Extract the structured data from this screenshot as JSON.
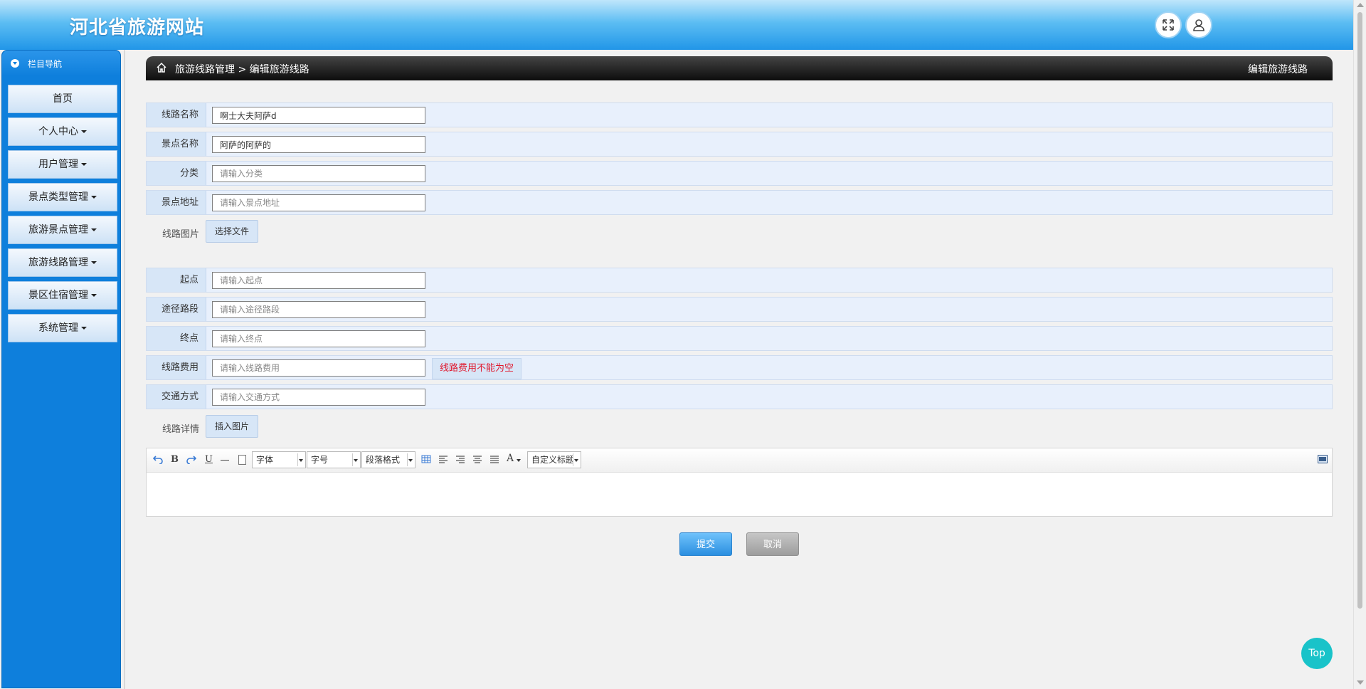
{
  "header": {
    "title": "河北省旅游网站"
  },
  "sidebar": {
    "heading": "栏目导航",
    "items": [
      {
        "label": "首页",
        "dropdown": false
      },
      {
        "label": "个人中心",
        "dropdown": true
      },
      {
        "label": "用户管理",
        "dropdown": true
      },
      {
        "label": "景点类型管理",
        "dropdown": true
      },
      {
        "label": "旅游景点管理",
        "dropdown": true
      },
      {
        "label": "旅游线路管理",
        "dropdown": true
      },
      {
        "label": "景区住宿管理",
        "dropdown": true
      },
      {
        "label": "系统管理",
        "dropdown": true
      }
    ]
  },
  "breadcrumb": {
    "parent": "旅游线路管理",
    "separator": ">",
    "current": "编辑旅游线路",
    "right_title": "编辑旅游线路"
  },
  "form": {
    "route_name": {
      "label": "线路名称",
      "value": "啊士大夫阿萨d",
      "placeholder": ""
    },
    "spot_name": {
      "label": "景点名称",
      "value": "阿萨的阿萨的",
      "placeholder": ""
    },
    "category": {
      "label": "分类",
      "value": "",
      "placeholder": "请输入分类"
    },
    "spot_address": {
      "label": "景点地址",
      "value": "",
      "placeholder": "请输入景点地址"
    },
    "route_image": {
      "label": "线路图片",
      "button": "选择文件"
    },
    "start": {
      "label": "起点",
      "value": "",
      "placeholder": "请输入起点"
    },
    "via": {
      "label": "途径路段",
      "value": "",
      "placeholder": "请输入途径路段"
    },
    "end": {
      "label": "终点",
      "value": "",
      "placeholder": "请输入终点"
    },
    "fee": {
      "label": "线路费用",
      "value": "",
      "placeholder": "请输入线路费用",
      "error": "线路费用不能为空"
    },
    "transport": {
      "label": "交通方式",
      "value": "",
      "placeholder": "请输入交通方式"
    },
    "details": {
      "label": "线路详情",
      "button": "插入图片"
    }
  },
  "editor": {
    "font_family": "字体",
    "font_size": "字号",
    "paragraph": "段落格式",
    "custom_title": "自定义标题",
    "bold": "B",
    "underline": "U",
    "font_color": "A"
  },
  "actions": {
    "submit": "提交",
    "cancel": "取消",
    "top": "Top"
  },
  "colors": {
    "header_blue": "#2196e8",
    "sidebar_blue": "#0e7fdc",
    "error_red": "#e0192e",
    "top_button": "#19c3c9"
  }
}
